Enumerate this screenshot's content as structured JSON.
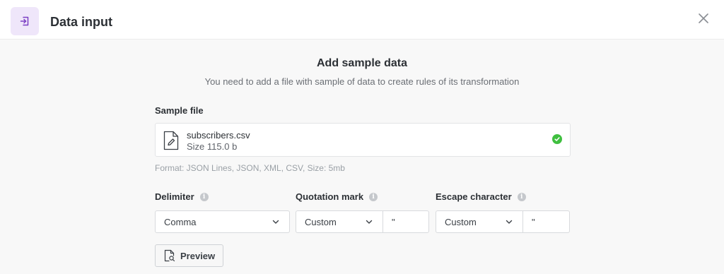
{
  "header": {
    "title": "Data input",
    "icon": "sign-in-icon",
    "icon_bg_color": "#efe6fa",
    "icon_color": "#7b3fc4",
    "close_icon": "close-icon"
  },
  "main": {
    "title": "Add sample data",
    "subtitle": "You need to add a file with sample of data to create rules of its transformation"
  },
  "sample_file": {
    "label": "Sample file",
    "file_name": "subscribers.csv",
    "file_size": "Size 115.0 b",
    "status_icon": "check-circle-icon",
    "status_color": "#3fbf3f",
    "format_hint": "Format: JSON Lines, JSON, XML, CSV, Size: 5mb"
  },
  "delimiter": {
    "label": "Delimiter",
    "value": "Comma"
  },
  "quotation_mark": {
    "label": "Quotation mark",
    "mode": "Custom",
    "char": "\""
  },
  "escape_character": {
    "label": "Escape character",
    "mode": "Custom",
    "char": "\""
  },
  "preview_button": {
    "label": "Preview"
  }
}
